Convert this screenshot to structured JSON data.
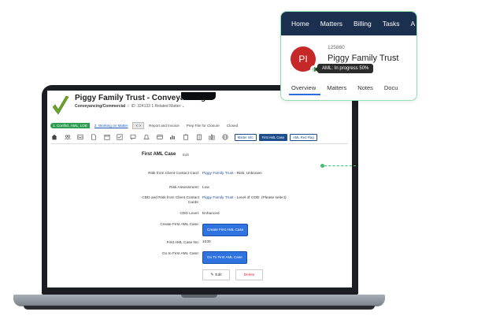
{
  "popup": {
    "nav": [
      "Home",
      "Matters",
      "Billing",
      "Tasks",
      "A"
    ],
    "avatar_initials": "PI",
    "matter_number": "125860",
    "matter_name": "Piggy Family Trust",
    "tooltip": "AML: In progress 50%",
    "aml_progress_percent": 50,
    "tabs": [
      "Overview",
      "Matters",
      "Notes",
      "Docu"
    ]
  },
  "app": {
    "matter_title": "Piggy Family Trust - Conveyancing",
    "matter_type": "Conveyancing/Commercial",
    "matter_id": "ID: 324133",
    "related": "1 Related Matter",
    "steps": [
      "1. Conflict, AML, LOE",
      "2. Working on Matter",
      "< >",
      "Report and Invoice",
      "Prep File for Closure",
      "Closed"
    ],
    "toolbar_buttons": [
      "Matter Info",
      "First AML Case",
      "AML Red Flag"
    ],
    "section_title": "First AML Case",
    "section_edit": "Edit",
    "fields": {
      "risk_label": "Risk from Client Contact Card:",
      "risk_value_link": "Piggy Family Trust",
      "risk_value_rest": " - Risk: Unknown",
      "assessment_label": "Risk Assessment:",
      "assessment_value": "Low",
      "cdd_label": "CDD and Risk from Client Contact Cards:",
      "cdd_value_link": "Piggy Family Trust",
      "cdd_value_rest": " - Level of CDD: (Please select)",
      "cdd_level_label": "CDD Level:",
      "cdd_level_value": "Enhanced",
      "create_label": "Create First AML Case:",
      "create_button": "Create First AML Case",
      "case_no_label": "First AML Case No:",
      "case_no_value": "1030",
      "goto_label": "Go to First AML Case:",
      "goto_button": "Go To First AML Case",
      "edit_button": "Edit",
      "delete_button": "Delete"
    }
  }
}
